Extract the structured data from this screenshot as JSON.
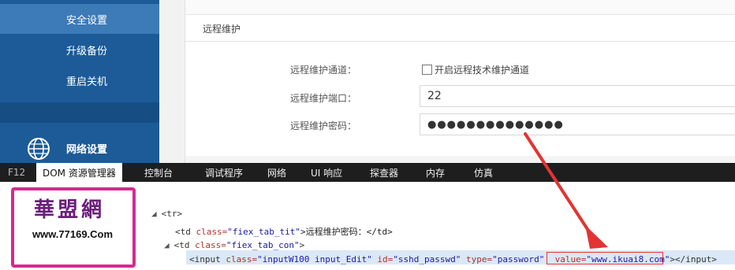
{
  "sidebar": {
    "items": [
      {
        "label": "安全设置"
      },
      {
        "label": "升级备份"
      },
      {
        "label": "重启关机"
      },
      {
        "label": "网络设置"
      }
    ]
  },
  "main": {
    "section_title": "远程维护",
    "rows": [
      {
        "label": "远程维护通道："
      },
      {
        "label": "远程维护端口："
      },
      {
        "label": "远程维护密码："
      }
    ],
    "checkbox_label": "开启远程技术维护通道",
    "port_value": "22",
    "password_mask": "●●●●●●●●●●●●●●"
  },
  "devtools": {
    "tabs": [
      {
        "label": "F12"
      },
      {
        "label": "DOM 资源管理器"
      },
      {
        "label": "控制台"
      },
      {
        "label": "调试程序"
      },
      {
        "label": "网络"
      },
      {
        "label": "UI 响应"
      },
      {
        "label": "探查器"
      },
      {
        "label": "内存"
      },
      {
        "label": "仿真"
      }
    ],
    "dom": {
      "line1": "<tr>",
      "line2_open": "<td ",
      "line2_attr": "class=",
      "line2_val": "\"fiex_tab_tit\"",
      "line2_text": ">远程维护密码：</td>",
      "line3_open": "<td ",
      "line3_attr": "class=",
      "line3_val": "\"fiex_tab_con\"",
      "line3_close": ">",
      "line4_open": "<input ",
      "line4_a1": "class=",
      "line4_v1": "\"inputW100 input_Edit\"",
      "line4_a2": " id=",
      "line4_v2": "\"sshd_passwd\"",
      "line4_a3": " type=",
      "line4_v3": "\"password\"",
      "line4_a4": "value=",
      "line4_v4": "\"www.ikuai8.com\"",
      "line4_end": "></input>"
    }
  },
  "watermark": {
    "cn": "華盟網",
    "url": "www.77169.Com"
  },
  "colors": {
    "sidebar": "#1c5b98",
    "sidebar_active": "#3d7ab8",
    "devtools_bar": "#1e1e1e",
    "highlight": "#e33333",
    "logo": "#d6298f"
  }
}
